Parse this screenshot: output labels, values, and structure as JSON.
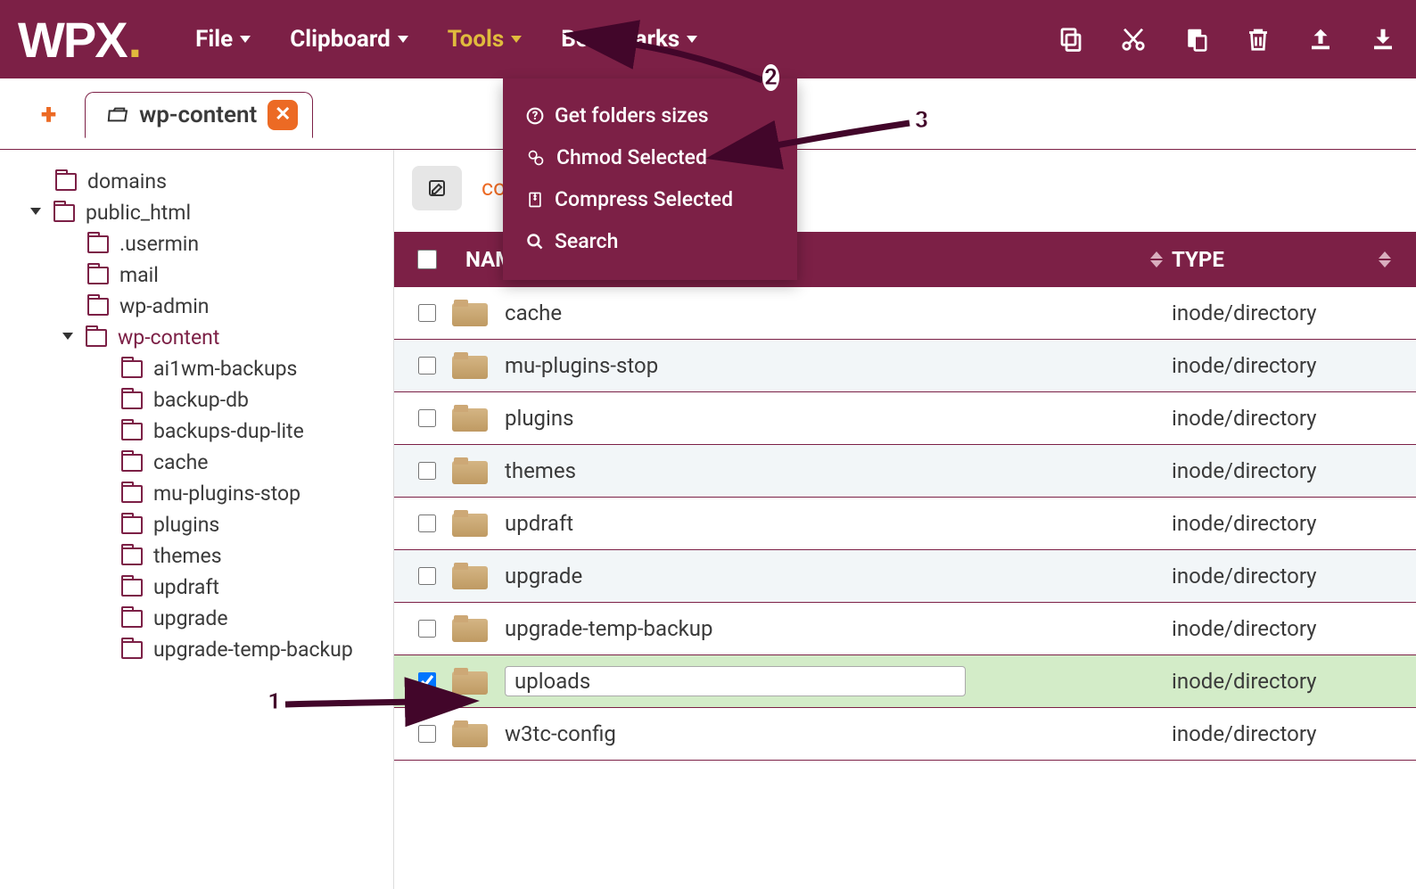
{
  "logo": {
    "text": "WPX",
    "dot": "."
  },
  "menu": [
    {
      "label": "File"
    },
    {
      "label": "Clipboard"
    },
    {
      "label": "Tools",
      "active": true
    },
    {
      "label": "Bookmarks"
    }
  ],
  "toolbar_icons": [
    "copy",
    "cut",
    "paste",
    "delete",
    "upload",
    "download"
  ],
  "tab": {
    "label": "wp-content"
  },
  "tree": [
    {
      "level": 0,
      "label": "domains",
      "icon": "closed"
    },
    {
      "level": 1,
      "label": "public_html",
      "icon": "open",
      "toggle": "open"
    },
    {
      "level": 2,
      "label": ".usermin",
      "icon": "closed"
    },
    {
      "level": 2,
      "label": "mail",
      "icon": "closed"
    },
    {
      "level": 2,
      "label": "wp-admin",
      "icon": "closed"
    },
    {
      "level": 3,
      "label": "wp-content",
      "icon": "open",
      "toggle": "open",
      "active": true
    },
    {
      "level": 4,
      "label": "ai1wm-backups",
      "icon": "closed"
    },
    {
      "level": 4,
      "label": "backup-db",
      "icon": "closed"
    },
    {
      "level": 4,
      "label": "backups-dup-lite",
      "icon": "closed"
    },
    {
      "level": 4,
      "label": "cache",
      "icon": "closed"
    },
    {
      "level": 4,
      "label": "mu-plugins-stop",
      "icon": "closed"
    },
    {
      "level": 4,
      "label": "plugins",
      "icon": "closed"
    },
    {
      "level": 4,
      "label": "themes",
      "icon": "closed"
    },
    {
      "level": 4,
      "label": "updraft",
      "icon": "closed"
    },
    {
      "level": 4,
      "label": "upgrade",
      "icon": "closed"
    },
    {
      "level": 4,
      "label": "upgrade-temp-backup",
      "icon": "closed"
    }
  ],
  "breadcrumb": "content",
  "table": {
    "headers": {
      "name": "NAME",
      "type": "TYPE"
    },
    "rows": [
      {
        "name": "cache",
        "type": "inode/directory",
        "checked": false
      },
      {
        "name": "mu-plugins-stop",
        "type": "inode/directory",
        "checked": false,
        "alt": true
      },
      {
        "name": "plugins",
        "type": "inode/directory",
        "checked": false
      },
      {
        "name": "themes",
        "type": "inode/directory",
        "checked": false,
        "alt": true
      },
      {
        "name": "updraft",
        "type": "inode/directory",
        "checked": false
      },
      {
        "name": "upgrade",
        "type": "inode/directory",
        "checked": false,
        "alt": true
      },
      {
        "name": "upgrade-temp-backup",
        "type": "inode/directory",
        "checked": false
      },
      {
        "name": "uploads",
        "type": "inode/directory",
        "checked": true,
        "selected": true
      },
      {
        "name": "w3tc-config",
        "type": "inode/directory",
        "checked": false
      }
    ]
  },
  "dropdown": {
    "items": [
      {
        "icon": "question",
        "label": "Get folders sizes"
      },
      {
        "icon": "gears",
        "label": "Chmod Selected"
      },
      {
        "icon": "archive",
        "label": "Compress Selected"
      },
      {
        "icon": "search",
        "label": "Search"
      }
    ]
  },
  "annotations": {
    "n1": "1",
    "n2": "2",
    "n3": "3"
  }
}
